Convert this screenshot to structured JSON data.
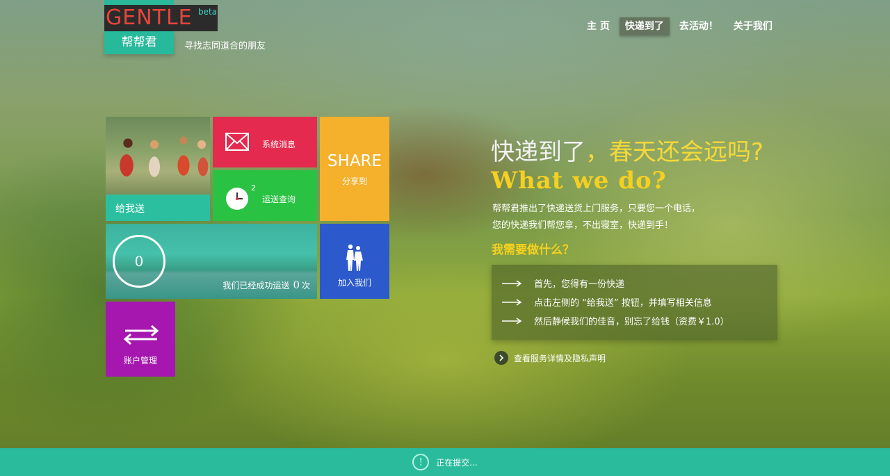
{
  "brand": {
    "logo_text": "GENTLE",
    "beta": "beta",
    "chinese_name": "帮帮君",
    "slogan": "寻找志同道合的朋友"
  },
  "nav": {
    "items": [
      {
        "label": "主 页",
        "active": false
      },
      {
        "label": "快递到了",
        "active": true
      },
      {
        "label": "去活动！",
        "active": false
      },
      {
        "label": "关于我们",
        "active": false
      }
    ]
  },
  "tiles": {
    "give": {
      "label": "给我送",
      "color": "#2bbf9f"
    },
    "message": {
      "label": "系统消息",
      "icon": "mail-icon",
      "color": "#e42b4f"
    },
    "track": {
      "label": "运送查询",
      "icon": "clock-icon",
      "badge": "2",
      "color": "#29c243"
    },
    "share": {
      "title": "SHARE",
      "subtitle": "分享到",
      "color": "#f5b02c"
    },
    "stats": {
      "ring_value": "0",
      "text": "我们已经成功运送",
      "count": "0",
      "unit": "次"
    },
    "join": {
      "label": "加入我们",
      "icon": "people-icon",
      "color": "#2c59cb"
    },
    "account": {
      "label": "账户管理",
      "icon": "swap-icon",
      "color": "#a517ae"
    }
  },
  "main": {
    "headline_white": "快递到了",
    "headline_yellow": "，春天还会远吗?",
    "what_we_do": "What we do?",
    "intro_line1": "帮帮君推出了快递送货上门服务，只要您一个电话，",
    "intro_line2": "您的快递我们帮您拿，不出寝室，快递到手！",
    "need_title": "我需要做什么？",
    "steps": [
      "首先，您得有一份快递",
      "点击左侧的 “给我送” 按钮，并填写相关信息",
      "然后静候我们的佳音，别忘了给钱（资费￥1.0）"
    ],
    "details_link": "查看服务详情及隐私声明"
  },
  "footer": {
    "icon": "alert-icon",
    "icon_glyph": "!",
    "status": "正在提交..."
  }
}
